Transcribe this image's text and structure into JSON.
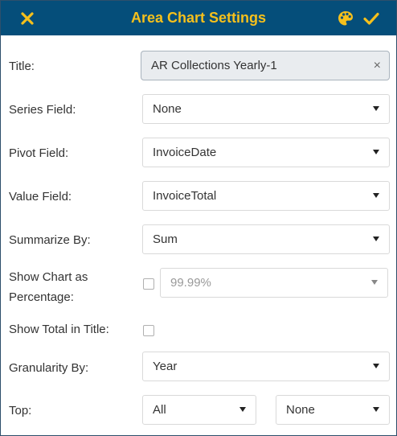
{
  "header": {
    "title": "Area Chart Settings",
    "close_icon": "close-icon",
    "palette_icon": "palette-icon",
    "confirm_icon": "checkmark-icon",
    "accent_color": "#f5c01c",
    "background_color": "#054e7a"
  },
  "fields": {
    "title": {
      "label": "Title:",
      "value": "AR Collections Yearly-1",
      "clear": "×"
    },
    "series_field": {
      "label": "Series Field:",
      "value": "None"
    },
    "pivot_field": {
      "label": "Pivot Field:",
      "value": "InvoiceDate"
    },
    "value_field": {
      "label": "Value Field:",
      "value": "InvoiceTotal"
    },
    "summarize_by": {
      "label": "Summarize By:",
      "value": "Sum"
    },
    "show_percentage": {
      "label_line1": "Show Chart as",
      "label_line2": "Percentage:",
      "checked": false,
      "value": "99.99%"
    },
    "show_total": {
      "label": "Show Total in Title:",
      "checked": false
    },
    "granularity_by": {
      "label": "Granularity By:",
      "value": "Year"
    },
    "top": {
      "label": "Top:",
      "value": "All",
      "secondary_value": "None"
    }
  }
}
